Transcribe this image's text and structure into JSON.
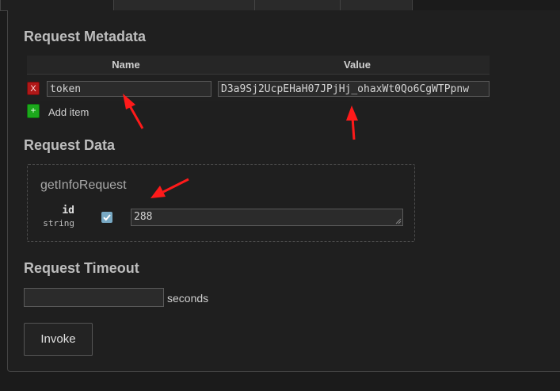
{
  "metadata": {
    "heading": "Request Metadata",
    "columns": {
      "name": "Name",
      "value": "Value"
    },
    "rows": [
      {
        "remove_label": "X",
        "name": "token",
        "value": "D3a9Sj2UcpEHaH07JPjHj_ohaxWt0Qo6CgWTPpnw"
      }
    ],
    "add": {
      "icon": "+",
      "label": "Add item"
    }
  },
  "request_data": {
    "heading": "Request Data",
    "message_name": "getInfoRequest",
    "fields": [
      {
        "name": "id",
        "type": "string",
        "checked": true,
        "value": "288"
      }
    ]
  },
  "timeout": {
    "heading": "Request Timeout",
    "value": "",
    "unit": "seconds"
  },
  "invoke": {
    "label": "Invoke"
  },
  "colors": {
    "remove": "#b01818",
    "add": "#1ca81c",
    "checkbox": "#78a9c4",
    "annotation": "#ff1a1a"
  }
}
